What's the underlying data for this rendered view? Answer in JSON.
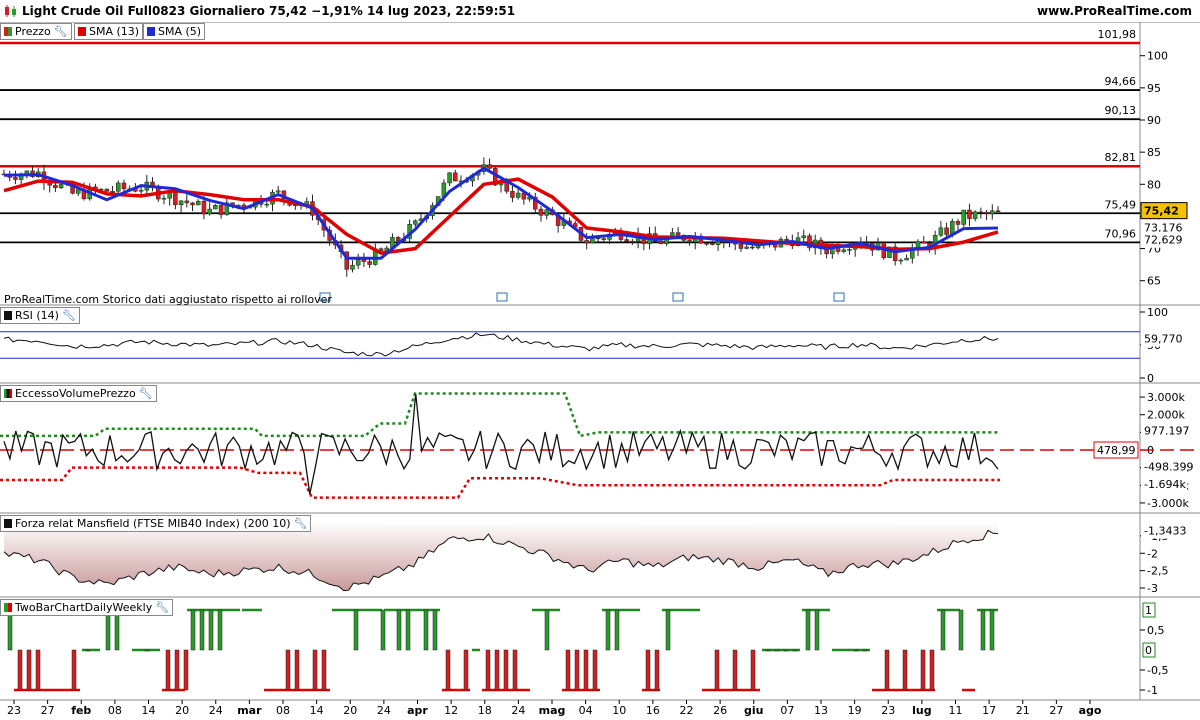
{
  "header": {
    "title": "Light Crude Oil Full0823 Giornaliero 75,42 −1,91% 14 lug 2023, 22:59:51",
    "site": "www.ProRealTime.com"
  },
  "colors": {
    "red": "#e00000",
    "blue": "#1f2ad6",
    "green_candle": "#2a9a2a",
    "red_candle": "#d02020",
    "mansfield_fill": "#c99a9a"
  },
  "price_panel": {
    "legend": {
      "prezzo": "Prezzo",
      "sma13": "SMA (13)",
      "sma5": "SMA (5)"
    },
    "note": "ProRealTime.com  Storico dati aggiustato rispetto ai rollover",
    "levels": [
      {
        "label": "101,98",
        "color": "red"
      },
      {
        "label": "94,66",
        "color": "black"
      },
      {
        "label": "90,13",
        "color": "black"
      },
      {
        "label": "82,81",
        "color": "red"
      },
      {
        "label": "75,49",
        "color": "black"
      },
      {
        "label": "70,96",
        "color": "black"
      }
    ],
    "axis_ticks": [
      "100",
      "95",
      "90",
      "85",
      "80",
      "75",
      "70",
      "65"
    ],
    "last_price": "75,42",
    "sma5_value": "73,176",
    "sma13_value": "72,629"
  },
  "rsi_panel": {
    "legend": "RSI (14)",
    "axis_ticks": [
      "100",
      "50",
      "0"
    ],
    "value": "59,770"
  },
  "evp_panel": {
    "legend": "EccessoVolumePrezzo",
    "axis_ticks": [
      "3.000k",
      "2.000k",
      "1.000k",
      "0",
      "-1.000k",
      "-2.000k",
      "-3.000k"
    ],
    "upper_value": "977.197",
    "zero_label": "478,99",
    "current_value": "-498.399",
    "lower_value": "-1.694k"
  },
  "mansfield_panel": {
    "legend": "Forza relat Mansfield (FTSE MIB40 Index) (200 10)",
    "axis_ticks": [
      "-1,5",
      "-2",
      "-2,5",
      "-3"
    ],
    "value": "-1,3433"
  },
  "tbc_panel": {
    "legend": "TwoBarChartDailyWeekly",
    "axis_ticks": [
      "0,5",
      "-0,5",
      "-1"
    ],
    "value_top": "1",
    "value_mid": "0"
  },
  "x_axis": {
    "ticks": [
      "23",
      "27",
      "feb",
      "08",
      "14",
      "20",
      "24",
      "mar",
      "08",
      "14",
      "20",
      "24",
      "apr",
      "12",
      "18",
      "24",
      "mag",
      "04",
      "10",
      "16",
      "22",
      "26",
      "giu",
      "07",
      "13",
      "19",
      "23",
      "lug",
      "11",
      "17",
      "21",
      "27",
      "ago"
    ],
    "bold_ticks": [
      "feb",
      "mar",
      "apr",
      "mag",
      "giu",
      "lug",
      "ago"
    ]
  },
  "chart_data": {
    "type": "line",
    "title": "Light Crude Oil Full0823 Giornaliero",
    "x": [
      "23",
      "27",
      "feb",
      "08",
      "14",
      "20",
      "24",
      "mar",
      "08",
      "14",
      "20",
      "24",
      "apr",
      "12",
      "18",
      "24",
      "mag",
      "04",
      "10",
      "16",
      "22",
      "26",
      "giu",
      "07",
      "13",
      "19",
      "23",
      "lug",
      "11",
      "17",
      "21",
      "27",
      "ago"
    ],
    "price_ylim": [
      62,
      104
    ],
    "series": [
      {
        "name": "Prezzo",
        "values": [
          81.6,
          81.8,
          78.5,
          79.0,
          79.6,
          77.9,
          75.8,
          77.0,
          78.5,
          76.0,
          66.9,
          69.3,
          73.6,
          80.9,
          82.2,
          78.0,
          75.0,
          71.2,
          72.5,
          71.0,
          72.0,
          71.2,
          69.9,
          71.5,
          69.9,
          71.5,
          68.7,
          70.8,
          75.0,
          75.4
        ]
      },
      {
        "name": "SMA (5)",
        "values": [
          81.4,
          81.5,
          79.8,
          77.6,
          79.8,
          79.3,
          77.5,
          76.2,
          78.4,
          76.3,
          68.5,
          68.5,
          73.0,
          78.9,
          82.5,
          79.5,
          75.8,
          71.7,
          72.2,
          71.4,
          71.9,
          71.3,
          70.6,
          71.1,
          70.0,
          70.8,
          69.5,
          70.2,
          73.1,
          73.2
        ]
      },
      {
        "name": "SMA (13)",
        "values": [
          79.0,
          80.5,
          80.3,
          78.5,
          78.2,
          79.0,
          78.4,
          77.6,
          77.6,
          76.5,
          72.2,
          69.3,
          70.0,
          75.0,
          80.0,
          80.8,
          78.0,
          73.2,
          72.6,
          71.8,
          71.7,
          71.6,
          71.2,
          70.8,
          70.5,
          70.3,
          69.9,
          70.0,
          71.0,
          72.6
        ]
      }
    ],
    "rsi": {
      "name": "RSI (14)",
      "ylim": [
        0,
        100
      ],
      "bands": [
        70,
        30
      ],
      "last": 59.77
    },
    "evp": {
      "name": "EccessoVolumePrezzo",
      "ylim": [
        -3400,
        3400
      ],
      "upper_band": 977.197,
      "lower_band": -1694,
      "zero_line": 478.99,
      "last": -498.399,
      "max": 3200,
      "min": -3000
    },
    "mansfield": {
      "name": "Forza relat Mansfield (FTSE MIB40 Index)",
      "ylim": [
        -3.2,
        -1.1
      ],
      "last": -1.3433
    },
    "two_bar": {
      "name": "TwoBarChartDailyWeekly",
      "ylim": [
        -1.1,
        1.1
      ],
      "last": 1
    }
  }
}
